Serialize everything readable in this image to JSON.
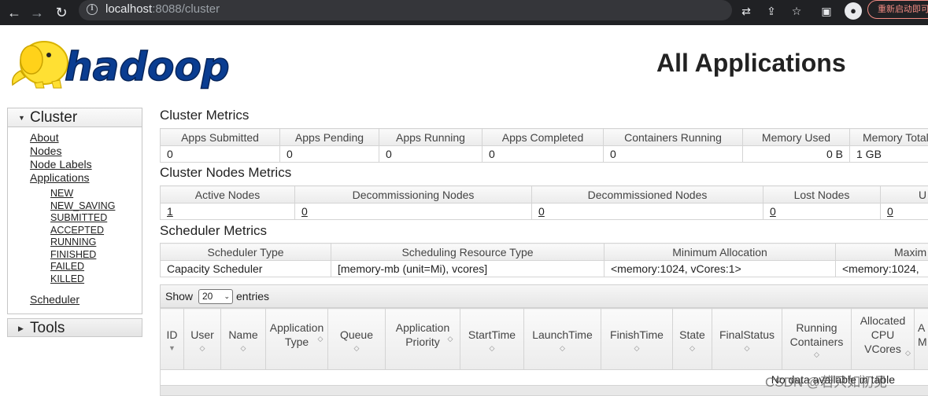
{
  "browser": {
    "url_host": "localhost",
    "url_rest": ":8088/cluster",
    "restart_label": "重新启动即可"
  },
  "header": {
    "logo_text": "hadoop",
    "title": "All Applications"
  },
  "sidebar": {
    "cluster_label": "Cluster",
    "links": [
      "About",
      "Nodes",
      "Node Labels",
      "Applications"
    ],
    "app_states": [
      "NEW",
      "NEW_SAVING",
      "SUBMITTED",
      "ACCEPTED",
      "RUNNING",
      "FINISHED",
      "FAILED",
      "KILLED"
    ],
    "scheduler_link": "Scheduler",
    "tools_label": "Tools"
  },
  "cluster_metrics": {
    "title": "Cluster Metrics",
    "headers": [
      "Apps Submitted",
      "Apps Pending",
      "Apps Running",
      "Apps Completed",
      "Containers Running",
      "Memory Used",
      "Memory Total"
    ],
    "values": [
      "0",
      "0",
      "0",
      "0",
      "0",
      "0 B",
      "1 GB"
    ]
  },
  "nodes_metrics": {
    "title": "Cluster Nodes Metrics",
    "headers": [
      "Active Nodes",
      "Decommissioning Nodes",
      "Decommissioned Nodes",
      "Lost Nodes",
      "U"
    ],
    "values": [
      "1",
      "0",
      "0",
      "0",
      "0"
    ]
  },
  "scheduler_metrics": {
    "title": "Scheduler Metrics",
    "headers": [
      "Scheduler Type",
      "Scheduling Resource Type",
      "Minimum Allocation",
      "Maxim"
    ],
    "values": [
      "Capacity Scheduler",
      "[memory-mb (unit=Mi), vcores]",
      "<memory:1024, vCores:1>",
      "<memory:1024,"
    ]
  },
  "entries": {
    "show_label": "Show",
    "selected": "20",
    "entries_label": "entries"
  },
  "apps_table": {
    "headers": [
      [
        "ID"
      ],
      [
        "User"
      ],
      [
        "Name"
      ],
      [
        "Application",
        "Type"
      ],
      [
        "Queue"
      ],
      [
        "Application",
        "Priority"
      ],
      [
        "StartTime"
      ],
      [
        "LaunchTime"
      ],
      [
        "FinishTime"
      ],
      [
        "State"
      ],
      [
        "FinalStatus"
      ],
      [
        "Running",
        "Containers"
      ],
      [
        "Allocated",
        "CPU",
        "VCores"
      ],
      [
        "A",
        "M"
      ]
    ],
    "empty_message": "No data available in table"
  },
  "watermark": "CSDN @若只如初见",
  "colors": {
    "chrome_bg": "#202124",
    "logo_yellow": "#ffe033",
    "logo_blue": "#0a3d91"
  }
}
